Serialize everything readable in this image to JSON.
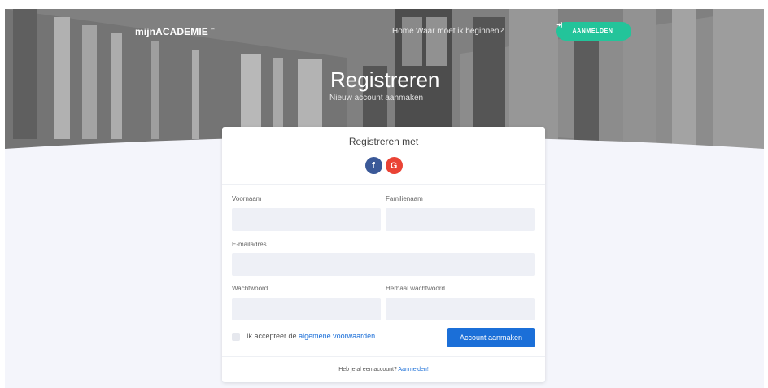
{
  "header": {
    "brand": "mijnACADEMIE",
    "brand_mark": "™",
    "nav": [
      "Home",
      "Waar moet ik beginnen?"
    ],
    "login_button": "AANMELDEN",
    "login_icon": "sign-in-icon"
  },
  "hero": {
    "title": "Registreren",
    "subtitle": "Nieuw account aanmaken"
  },
  "card": {
    "social_title": "Registreren met",
    "social": [
      {
        "label": "f",
        "icon": "facebook-icon",
        "color": "#3b5998"
      },
      {
        "label": "G",
        "icon": "google-icon",
        "color": "#ea4335"
      }
    ],
    "fields": {
      "firstname": {
        "label": "Voornaam",
        "value": ""
      },
      "lastname": {
        "label": "Familienaam",
        "value": ""
      },
      "email": {
        "label": "E-mailadres",
        "value": ""
      },
      "password": {
        "label": "Wachtwoord",
        "value": ""
      },
      "password_repeat": {
        "label": "Herhaal wachtwoord",
        "value": ""
      }
    },
    "terms": {
      "prefix": "Ik accepteer de",
      "link": "algemene voorwaarden",
      "suffix": "."
    },
    "submit": "Account aanmaken",
    "footer": {
      "text": "Heb je al een account?",
      "link": "Aanmelden!"
    }
  },
  "colors": {
    "accent_green": "#23c49a",
    "primary_blue": "#1b6fd8",
    "page_bg": "#f4f5fb"
  }
}
